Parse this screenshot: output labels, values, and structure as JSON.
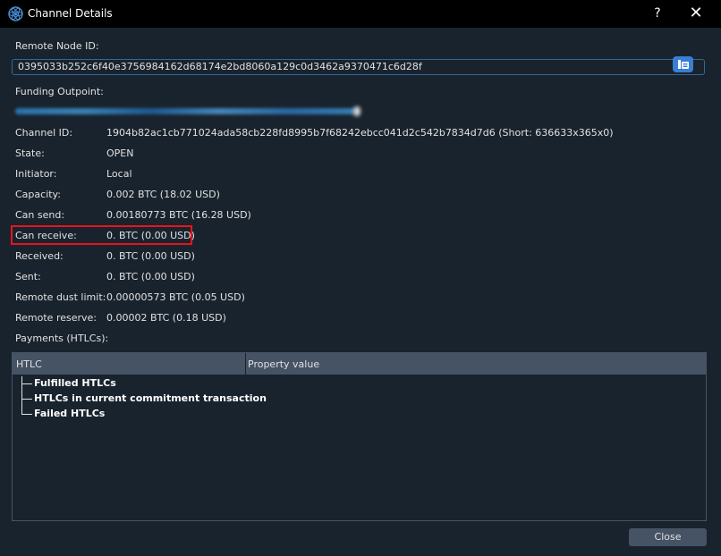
{
  "window": {
    "title": "Channel Details",
    "help_label": "?",
    "close_label": "✕"
  },
  "remote_node": {
    "label": "Remote Node ID:",
    "value": "0395033b252c6f40e3756984162d68174e2bd8060a129c0d3462a9370471c6d28f"
  },
  "funding": {
    "label": "Funding Outpoint:"
  },
  "fields": [
    {
      "label": "Channel ID:",
      "value": "1904b82ac1cb771024ada58cb228fd8995b7f68242ebcc041d2c542b7834d7d6 (Short: 636633x365x0)"
    },
    {
      "label": "State:",
      "value": "OPEN"
    },
    {
      "label": "Initiator:",
      "value": "Local"
    },
    {
      "label": "Capacity:",
      "value": "0.002 BTC (18.02 USD)"
    },
    {
      "label": "Can send:",
      "value": "0.00180773 BTC (16.28 USD)"
    },
    {
      "label": "Can receive:",
      "value": "0. BTC (0.00 USD)"
    },
    {
      "label": "Received:",
      "value": "0. BTC (0.00 USD)"
    },
    {
      "label": "Sent:",
      "value": "0. BTC (0.00 USD)"
    },
    {
      "label": "Remote dust limit:",
      "value": "0.00000573 BTC (0.05 USD)"
    },
    {
      "label": "Remote reserve:",
      "value": "0.00002 BTC (0.18 USD)"
    }
  ],
  "payments": {
    "label": "Payments (HTLCs):",
    "columns": [
      "HTLC",
      "Property value"
    ],
    "items": [
      "Fulfilled HTLCs",
      "HTLCs in current commitment transaction",
      "Failed HTLCs"
    ]
  },
  "footer": {
    "close_label": "Close"
  },
  "colors": {
    "highlight": "#e8141c",
    "accent": "#3a7fd5",
    "background": "#19232d"
  }
}
